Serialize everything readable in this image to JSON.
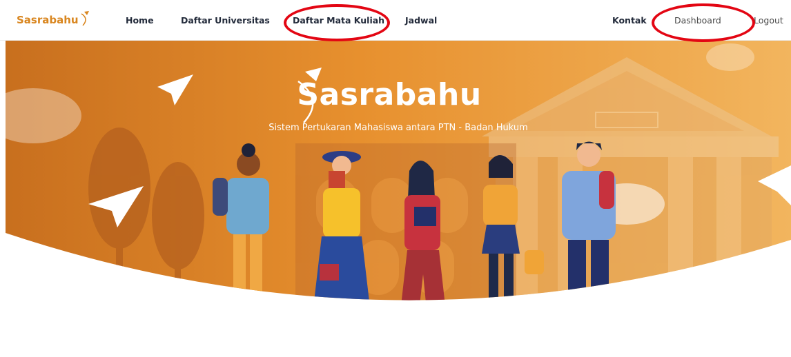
{
  "navbar": {
    "brand": "Sasrabahu",
    "links": [
      {
        "label": "Home"
      },
      {
        "label": "Daftar Universitas"
      },
      {
        "label": "Daftar Mata Kuliah"
      },
      {
        "label": "Jadwal"
      },
      {
        "label": "Kontak"
      },
      {
        "label": "Dashboard"
      },
      {
        "label": "Logout"
      }
    ]
  },
  "hero": {
    "title": "Sasrabahu",
    "tagline": "Sistem Pertukaran Mahasiswa antara PTN - Badan Hukum"
  },
  "colors": {
    "brand": "#d9861f",
    "hero_orange": "#e28a2b",
    "highlight_circle": "#e30613",
    "nav_text": "#222a3a"
  },
  "icons": [
    "paper-plane-icon",
    "brand-arc-icon",
    "building-illustration",
    "tree-illustration",
    "students-illustration"
  ]
}
